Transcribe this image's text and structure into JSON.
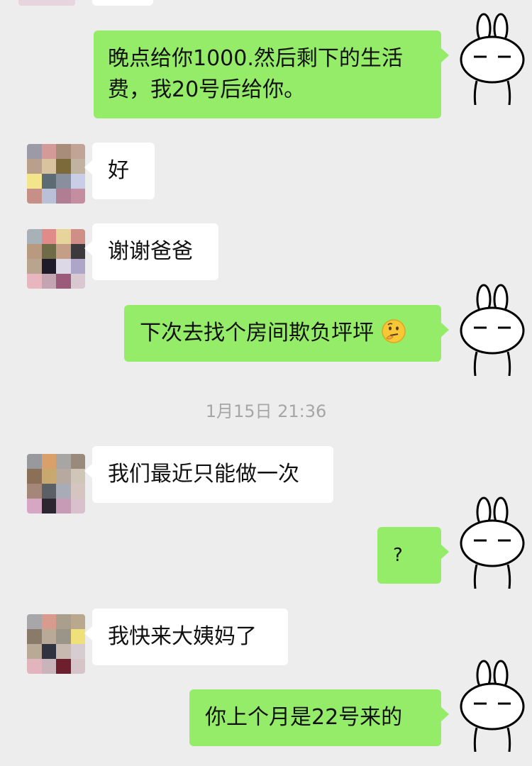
{
  "timestamp": "1月15日 21:36",
  "messages": [
    {
      "side": "out",
      "line1": "晚点给你1000.然后剩下的生活",
      "line2": "费，我20号后给你。"
    },
    {
      "side": "in",
      "text": "好"
    },
    {
      "side": "in",
      "text": "谢谢爸爸"
    },
    {
      "side": "out",
      "text": "下次去找个房间欺负坪坪"
    },
    {
      "side": "in",
      "text": "我们最近只能做一次"
    },
    {
      "side": "out",
      "text": "?"
    },
    {
      "side": "in",
      "text": "我快来大姨妈了"
    },
    {
      "side": "out",
      "text": "你上个月是22号来的"
    }
  ],
  "icons": {
    "emoji": "thinking-face-emoji-icon",
    "self_avatar": "rabbit-sticker-avatar-icon"
  },
  "colors": {
    "background": "#ededed",
    "outgoing_bubble": "#95ec69",
    "incoming_bubble": "#ffffff",
    "timestamp": "#a6a6a6"
  }
}
